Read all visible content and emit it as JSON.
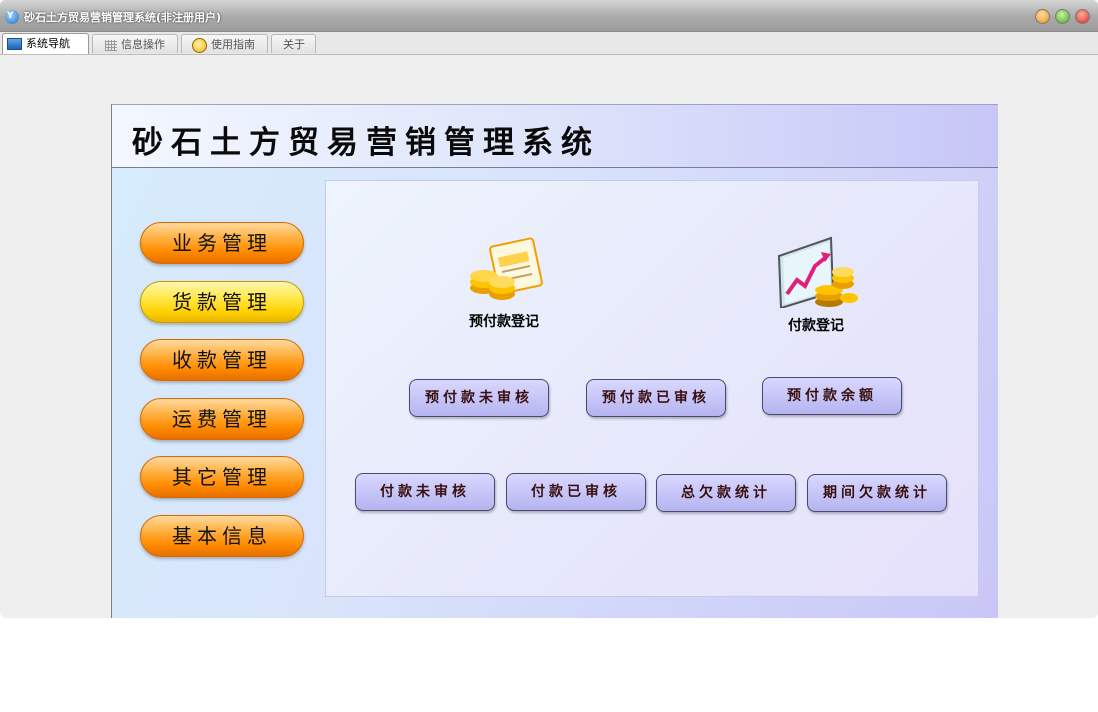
{
  "window": {
    "title": "砂石土方贸易营销管理系统(非注册用户)"
  },
  "tabs": [
    {
      "label": "系统导航",
      "icon": "monitor-icon"
    },
    {
      "label": "信息操作",
      "icon": "grid-icon"
    },
    {
      "label": "使用指南",
      "icon": "help-bulb-icon"
    },
    {
      "label": "关于"
    }
  ],
  "panel": {
    "title": "砂石土方贸易营销管理系统"
  },
  "sidebar": {
    "items": [
      {
        "label": "业务管理"
      },
      {
        "label": "货款管理"
      },
      {
        "label": "收款管理"
      },
      {
        "label": "运费管理"
      },
      {
        "label": "其它管理"
      },
      {
        "label": "基本信息"
      }
    ]
  },
  "features": [
    {
      "label": "预付款登记",
      "icon": "coins-card-icon"
    },
    {
      "label": "付款登记",
      "icon": "chart-coins-icon"
    }
  ],
  "actions": {
    "row1": [
      "预付款未审核",
      "预付款已审核",
      "预付款余额"
    ],
    "row2": [
      "付款未审核",
      "付款已审核",
      "总欠款统计",
      "期间欠款统计"
    ]
  },
  "colors": {
    "accent_orange": "#ff8c00",
    "accent_yellow": "#ffd000",
    "action_button": "#c3c2f7"
  }
}
